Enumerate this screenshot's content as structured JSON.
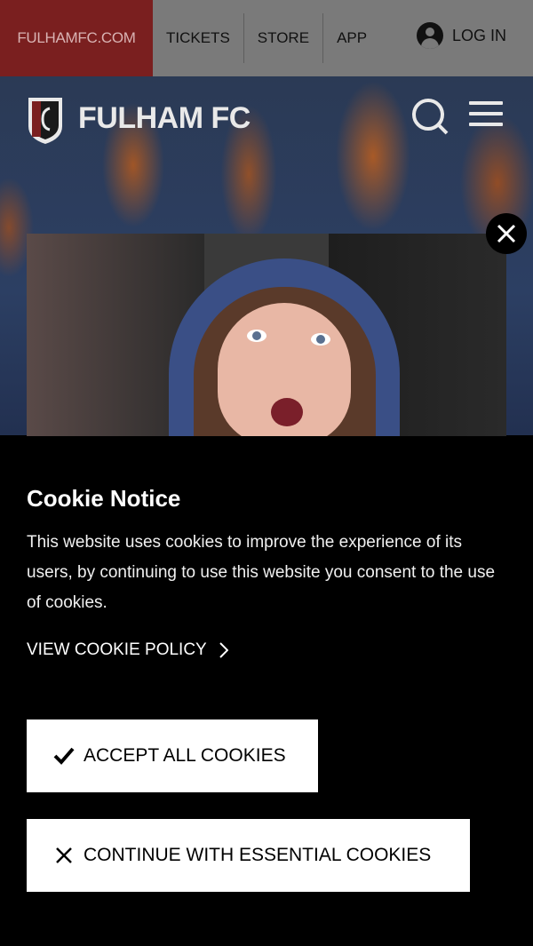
{
  "topbar": {
    "brand_link": "FULHAMFC.COM",
    "links": [
      "TICKETS",
      "STORE",
      "APP"
    ],
    "login_label": "LOG IN"
  },
  "header": {
    "club_name": "FULHAM FC"
  },
  "cookie_notice": {
    "title": "Cookie Notice",
    "body": "This website uses cookies to improve the experience of its users, by continuing to use this website you consent to the use of cookies.",
    "policy_link": "VIEW COOKIE POLICY",
    "accept_label": "ACCEPT ALL COOKIES",
    "essential_label": "CONTINUE WITH ESSENTIAL COOKIES"
  },
  "colors": {
    "topbar_bg": "#7a7a7a",
    "brand_bg": "#7a1f1f",
    "panel_bg": "#000000",
    "button_bg": "#ffffff"
  },
  "icons": [
    "user-icon",
    "crest-logo",
    "search-icon",
    "menu-icon",
    "close-icon",
    "chevron-right-icon",
    "checkmark-icon",
    "x-icon"
  ]
}
